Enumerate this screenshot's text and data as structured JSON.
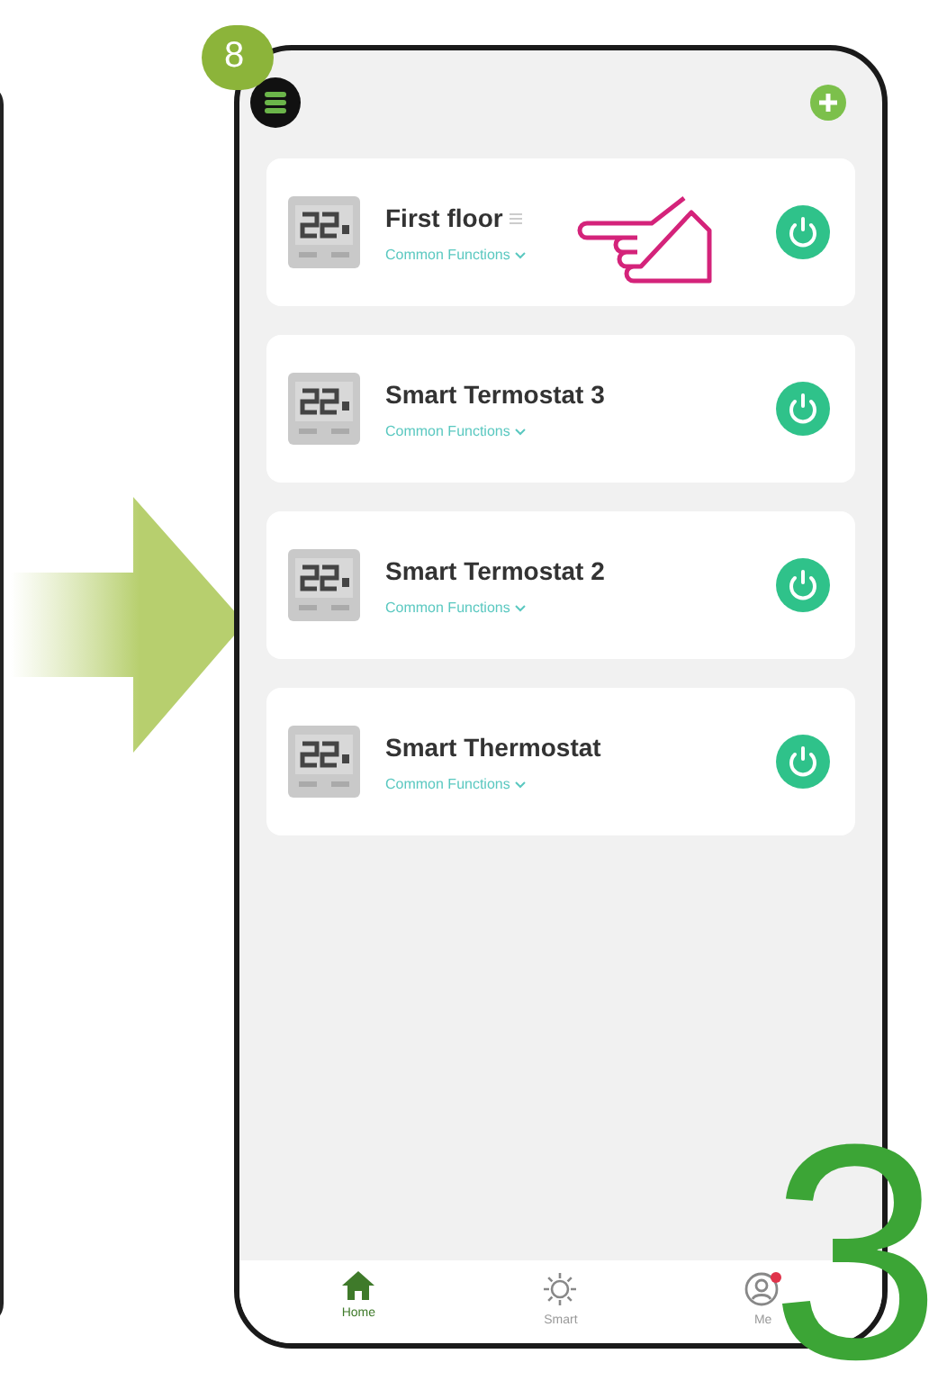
{
  "step_badge": "8",
  "page_number": "3",
  "devices": [
    {
      "name": "First floor",
      "subtitle": "Common Functions",
      "on": true,
      "pointer": true
    },
    {
      "name": "Smart Termostat 3",
      "subtitle": "Common Functions",
      "on": true,
      "pointer": false
    },
    {
      "name": "Smart Termostat 2",
      "subtitle": "Common Functions",
      "on": true,
      "pointer": false
    },
    {
      "name": "Smart Thermostat",
      "subtitle": "Common Functions",
      "on": true,
      "pointer": false
    }
  ],
  "tabs": [
    {
      "label": "Home",
      "kind": "home",
      "selected": true
    },
    {
      "label": "Smart",
      "kind": "smart",
      "selected": false
    },
    {
      "label": "Me",
      "kind": "me",
      "selected": false
    }
  ]
}
